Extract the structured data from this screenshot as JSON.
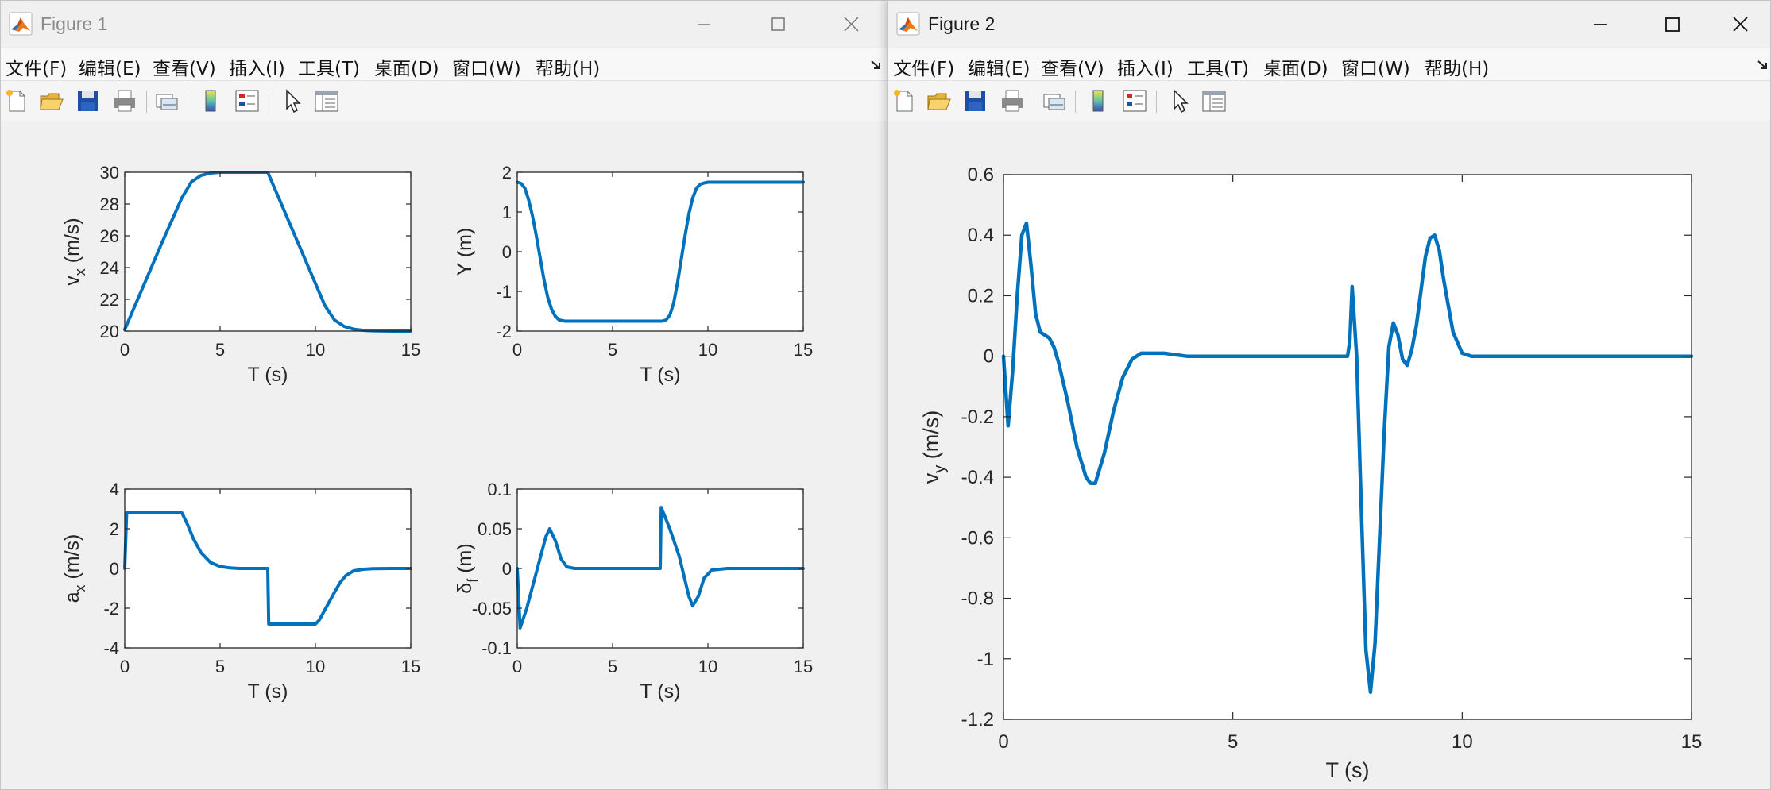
{
  "colors": {
    "line": "#0072bd",
    "axes_bg": "#ffffff",
    "figure_bg": "#f0f0f0",
    "axis_color": "#262626"
  },
  "windows": [
    {
      "title": "Figure 1",
      "active": false,
      "menu": [
        "文件(F)",
        "编辑(E)",
        "查看(V)",
        "插入(I)",
        "工具(T)",
        "桌面(D)",
        "窗口(W)",
        "帮助(H)"
      ],
      "toolbar_icons": [
        "new-figure-icon",
        "open-file-icon",
        "save-icon",
        "print-icon",
        "link-plot-icon",
        "colorbar-icon",
        "legend-icon",
        "edit-plot-arrow-icon",
        "property-inspector-icon"
      ]
    },
    {
      "title": "Figure 2",
      "active": true,
      "menu": [
        "文件(F)",
        "编辑(E)",
        "查看(V)",
        "插入(I)",
        "工具(T)",
        "桌面(D)",
        "窗口(W)",
        "帮助(H)"
      ],
      "toolbar_icons": [
        "new-figure-icon",
        "open-file-icon",
        "save-icon",
        "print-icon",
        "link-plot-icon",
        "colorbar-icon",
        "legend-icon",
        "edit-plot-arrow-icon",
        "property-inspector-icon"
      ]
    }
  ],
  "chart_data": [
    {
      "type": "line",
      "xlabel": "T (s)",
      "ylabel": "v",
      "ylabel_sub": "x",
      "ylabel_unit": "(m/s)",
      "xlim": [
        0,
        15
      ],
      "ylim": [
        20,
        30
      ],
      "xticks": [
        0,
        5,
        10,
        15
      ],
      "yticks": [
        20,
        22,
        24,
        26,
        28,
        30
      ],
      "grid": false,
      "series": [
        {
          "x": [
            0,
            1,
            2,
            3,
            3.5,
            4,
            4.5,
            5,
            6,
            7,
            7.5,
            8,
            9,
            10,
            10.5,
            11,
            11.5,
            12,
            12.5,
            13,
            14,
            15
          ],
          "y": [
            20.1,
            22.9,
            25.7,
            28.4,
            29.4,
            29.8,
            29.95,
            30,
            30,
            30,
            30,
            28.6,
            25.8,
            23.0,
            21.6,
            20.7,
            20.3,
            20.12,
            20.05,
            20.02,
            20.0,
            20.0
          ]
        }
      ]
    },
    {
      "type": "line",
      "xlabel": "T (s)",
      "ylabel": "Y",
      "ylabel_sub": "",
      "ylabel_unit": "(m)",
      "xlim": [
        0,
        15
      ],
      "ylim": [
        -2,
        2
      ],
      "xticks": [
        0,
        5,
        10,
        15
      ],
      "yticks": [
        -2,
        -1,
        0,
        1,
        2
      ],
      "grid": false,
      "series": [
        {
          "x": [
            0,
            0.2,
            0.4,
            0.6,
            0.8,
            1.0,
            1.2,
            1.4,
            1.6,
            1.8,
            2.0,
            2.2,
            2.5,
            3,
            4,
            5,
            6,
            7,
            7.6,
            7.8,
            8.0,
            8.2,
            8.4,
            8.6,
            8.8,
            9.0,
            9.2,
            9.4,
            9.6,
            9.8,
            10,
            10.5,
            11,
            12,
            13,
            14,
            15
          ],
          "y": [
            1.75,
            1.72,
            1.6,
            1.3,
            0.9,
            0.4,
            -0.15,
            -0.7,
            -1.15,
            -1.45,
            -1.63,
            -1.72,
            -1.75,
            -1.75,
            -1.75,
            -1.75,
            -1.75,
            -1.75,
            -1.75,
            -1.72,
            -1.6,
            -1.3,
            -0.8,
            -0.2,
            0.4,
            0.95,
            1.35,
            1.6,
            1.7,
            1.73,
            1.75,
            1.75,
            1.75,
            1.75,
            1.75,
            1.75,
            1.75
          ]
        }
      ]
    },
    {
      "type": "line",
      "xlabel": "T (s)",
      "ylabel": "a",
      "ylabel_sub": "x",
      "ylabel_unit": "(m/s)",
      "xlim": [
        0,
        15
      ],
      "ylim": [
        -4,
        4
      ],
      "xticks": [
        0,
        5,
        10,
        15
      ],
      "yticks": [
        -4,
        -2,
        0,
        2,
        4
      ],
      "grid": false,
      "series": [
        {
          "x": [
            0,
            0.1,
            1,
            2,
            3,
            3.3,
            3.6,
            4,
            4.5,
            5,
            5.5,
            6,
            7,
            7.5,
            7.55,
            8,
            9,
            10,
            10.2,
            10.6,
            11,
            11.3,
            11.6,
            12,
            12.5,
            13,
            14,
            15
          ],
          "y": [
            0,
            2.8,
            2.8,
            2.8,
            2.8,
            2.2,
            1.5,
            0.8,
            0.3,
            0.1,
            0.03,
            0.0,
            0.0,
            0.0,
            -2.8,
            -2.8,
            -2.8,
            -2.8,
            -2.6,
            -1.9,
            -1.2,
            -0.7,
            -0.35,
            -0.12,
            -0.04,
            -0.01,
            0.0,
            0.0
          ]
        }
      ]
    },
    {
      "type": "line",
      "xlabel": "T (s)",
      "ylabel": "δ",
      "ylabel_sub": "f",
      "ylabel_unit": "(m)",
      "xlim": [
        0,
        15
      ],
      "ylim": [
        -0.1,
        0.1
      ],
      "xticks": [
        0,
        5,
        10,
        15
      ],
      "yticks": [
        -0.1,
        -0.05,
        0,
        0.05,
        0.1
      ],
      "grid": false,
      "series": [
        {
          "x": [
            0,
            0.15,
            0.5,
            1,
            1.5,
            1.7,
            2.0,
            2.3,
            2.6,
            3,
            4,
            5,
            6,
            7,
            7.5,
            7.55,
            8,
            8.5,
            9,
            9.2,
            9.5,
            9.8,
            10.2,
            11,
            12,
            15
          ],
          "y": [
            0,
            -0.075,
            -0.05,
            -0.005,
            0.04,
            0.05,
            0.035,
            0.012,
            0.002,
            0,
            0,
            0,
            0,
            0,
            0,
            0.077,
            0.05,
            0.015,
            -0.035,
            -0.047,
            -0.035,
            -0.012,
            -0.002,
            0,
            0,
            0
          ]
        }
      ]
    },
    {
      "type": "line",
      "xlabel": "T (s)",
      "ylabel": "v",
      "ylabel_sub": "y",
      "ylabel_unit": "(m/s)",
      "xlim": [
        0,
        15
      ],
      "ylim": [
        -1.2,
        0.6
      ],
      "xticks": [
        0,
        5,
        10,
        15
      ],
      "yticks": [
        -1.2,
        -1,
        -0.8,
        -0.6,
        -0.4,
        -0.2,
        0,
        0.2,
        0.4,
        0.6
      ],
      "grid": false,
      "series": [
        {
          "x": [
            0,
            0.1,
            0.2,
            0.3,
            0.4,
            0.5,
            0.6,
            0.7,
            0.8,
            0.9,
            1.0,
            1.1,
            1.2,
            1.4,
            1.6,
            1.8,
            1.9,
            2.0,
            2.2,
            2.4,
            2.6,
            2.8,
            3.0,
            3.5,
            4,
            5,
            6,
            7,
            7.5,
            7.55,
            7.6,
            7.7,
            7.8,
            7.9,
            8.0,
            8.1,
            8.2,
            8.3,
            8.4,
            8.5,
            8.6,
            8.7,
            8.8,
            8.9,
            9.0,
            9.2,
            9.3,
            9.4,
            9.5,
            9.6,
            9.8,
            10.0,
            10.2,
            10.5,
            11,
            12,
            13,
            15
          ],
          "y": [
            0,
            -0.23,
            -0.05,
            0.2,
            0.4,
            0.44,
            0.3,
            0.14,
            0.08,
            0.07,
            0.06,
            0.03,
            -0.02,
            -0.15,
            -0.3,
            -0.4,
            -0.42,
            -0.42,
            -0.32,
            -0.18,
            -0.07,
            -0.01,
            0.01,
            0.01,
            0,
            0,
            0,
            0,
            0,
            0.05,
            0.23,
            0.0,
            -0.5,
            -0.97,
            -1.11,
            -0.95,
            -0.6,
            -0.25,
            0.03,
            0.11,
            0.07,
            -0.01,
            -0.03,
            0.02,
            0.1,
            0.33,
            0.39,
            0.4,
            0.35,
            0.25,
            0.08,
            0.01,
            0.0,
            0.0,
            0,
            0,
            0,
            0
          ]
        }
      ]
    }
  ]
}
